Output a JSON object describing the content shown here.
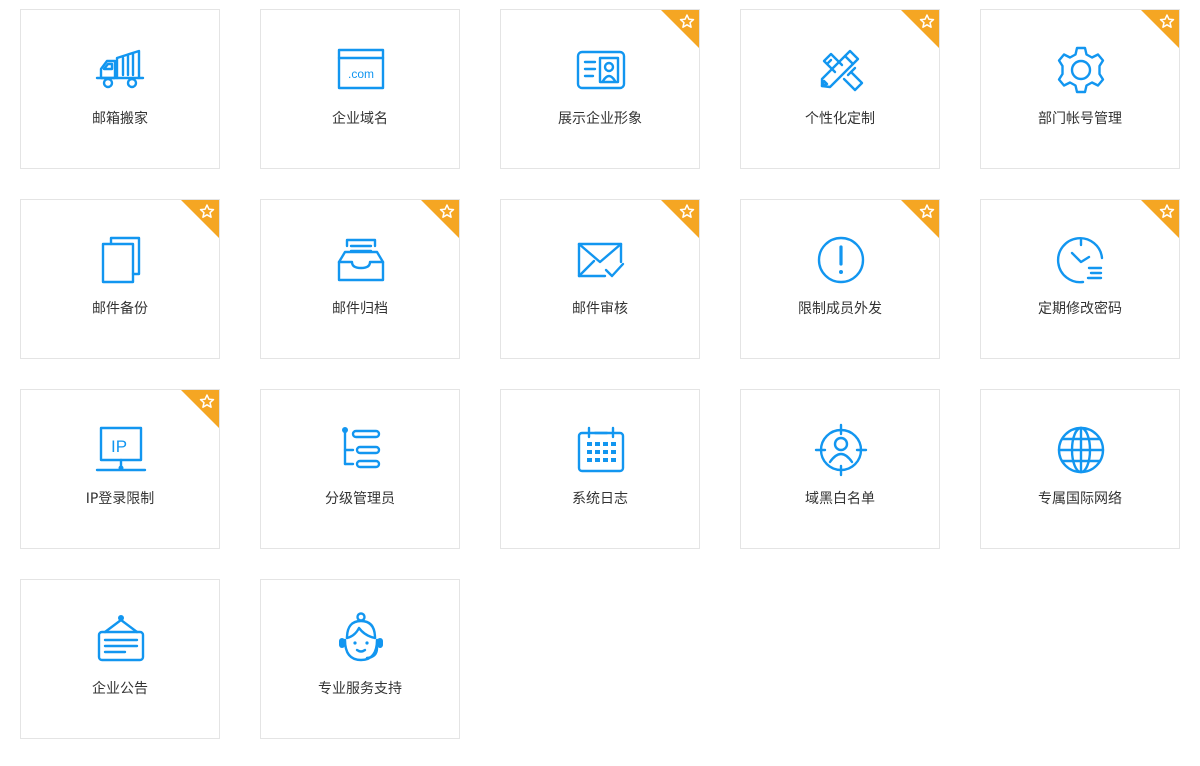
{
  "accent_color": "#1296f0",
  "badge_color": "#f5a623",
  "features": [
    {
      "label": "邮箱搬家",
      "icon": "mail-truck-icon",
      "premium": false
    },
    {
      "label": "企业域名",
      "icon": "domain-com-icon",
      "premium": false
    },
    {
      "label": "展示企业形象",
      "icon": "business-card-icon",
      "premium": true
    },
    {
      "label": "个性化定制",
      "icon": "pencil-ruler-icon",
      "premium": true
    },
    {
      "label": "部门帐号管理",
      "icon": "gear-icon",
      "premium": true
    },
    {
      "label": "邮件备份",
      "icon": "copy-pages-icon",
      "premium": true
    },
    {
      "label": "邮件归档",
      "icon": "archive-tray-icon",
      "premium": true
    },
    {
      "label": "邮件审核",
      "icon": "envelope-check-icon",
      "premium": true
    },
    {
      "label": "限制成员外发",
      "icon": "exclamation-circle-icon",
      "premium": true
    },
    {
      "label": "定期修改密码",
      "icon": "clock-icon",
      "premium": true
    },
    {
      "label": "IP登录限制",
      "icon": "ip-monitor-icon",
      "premium": true
    },
    {
      "label": "分级管理员",
      "icon": "hierarchy-list-icon",
      "premium": false
    },
    {
      "label": "系统日志",
      "icon": "calendar-icon",
      "premium": false
    },
    {
      "label": "域黑白名单",
      "icon": "target-user-icon",
      "premium": false
    },
    {
      "label": "专属国际网络",
      "icon": "globe-icon",
      "premium": false
    },
    {
      "label": "企业公告",
      "icon": "notice-board-icon",
      "premium": false
    },
    {
      "label": "专业服务支持",
      "icon": "support-agent-icon",
      "premium": false
    }
  ]
}
